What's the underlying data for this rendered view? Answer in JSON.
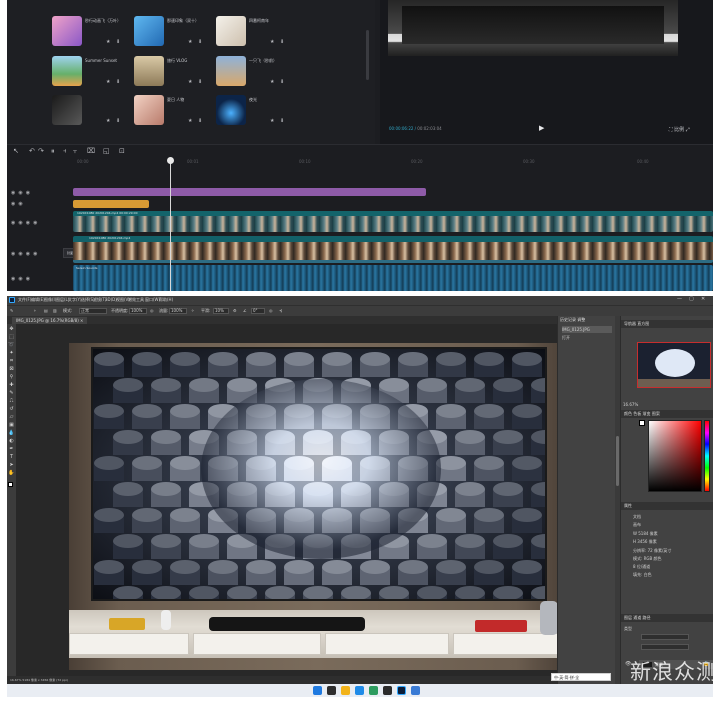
{
  "editor": {
    "media_items": [
      {
        "title": "秒行动画飞（万叶）",
        "sub": "",
        "thumb": "#d56aa8"
      },
      {
        "title": "那速印象（双十）",
        "sub": "",
        "thumb": "#3b8fd3"
      },
      {
        "title": "四番柯南年",
        "sub": "",
        "thumb": "#e2e0dc"
      },
      {
        "title": "Summer Sunset",
        "sub": "",
        "thumb": "#3f8f5a"
      },
      {
        "title": "旅行 VLOG",
        "sub": "",
        "thumb": "#c8b08a"
      },
      {
        "title": "一只飞（秒前）",
        "sub": "",
        "thumb": "#6a8bbf"
      },
      {
        "title": "",
        "sub": "",
        "thumb": "#2d2d2d"
      },
      {
        "title": "夏日 人物",
        "sub": "",
        "thumb": "#e8c2b8"
      },
      {
        "title": "夜光",
        "sub": "",
        "thumb": "#0e2748"
      }
    ],
    "preview": {
      "time_current": "00:00:06:22",
      "time_total": "00:02:03:04",
      "ratio_label": "比例"
    },
    "ruler_ticks": [
      "00:00",
      "00:01",
      "00:10",
      "00:20",
      "00:30",
      "00:40",
      "00:50"
    ],
    "tracks": {
      "film_label": "1920X1080 20201204.mp4  00:00:29:00",
      "film2_label": "1920X1080 20201204.mp4",
      "audio_label": "Serein Sounds"
    },
    "cover_label": "封面"
  },
  "photoshop": {
    "menus": [
      "文件(F)",
      "编辑(E)",
      "图像(I)",
      "图层(L)",
      "文字(Y)",
      "选择(S)",
      "滤镜(T)",
      "3D(D)",
      "视图(V)",
      "增效工具",
      "窗口(W)",
      "帮助(H)"
    ],
    "options": {
      "mode_label": "模式:",
      "mode_value": "正常",
      "opacity_label": "不透明度:",
      "opacity_value": "100%",
      "flow_label": "流量:",
      "flow_value": "100%",
      "smooth_label": "平滑:",
      "smooth_value": "10%",
      "angle_value": "0°"
    },
    "doc_tab": "IMG_0125.JPG @ 16.7%(RGB/8)",
    "layers_panel": {
      "tab": "历史记录  调整",
      "rows": [
        "IMG_0125.JPG",
        "打开"
      ]
    },
    "navigator": {
      "tab": "导航器  直方图",
      "zoom": "16.67%"
    },
    "color": {
      "tab": "颜色  色板  渐变  图案"
    },
    "properties": {
      "tab": "属性",
      "lines": [
        "文档",
        "画布",
        "W  5184 像素",
        "H  3456 像素",
        "分辨率: 72 像素/英寸",
        "模式: RGB 颜色",
        "8 位/通道",
        "填充: 白色"
      ]
    },
    "layers": {
      "tab": "图层  通道  路径",
      "kind": "类型",
      "layer_name": "背景"
    },
    "status": "16.67%   5184 像素 x 3456 像素 (72 ppi)"
  },
  "tray_text": "中·英·简·拼·全",
  "watermark": "新浪众测",
  "colors": {
    "ps_accent": "#31a8ff",
    "timeline_teal": "#13646b",
    "clip_purple": "#8e5ba8",
    "clip_orange": "#d79a34"
  }
}
